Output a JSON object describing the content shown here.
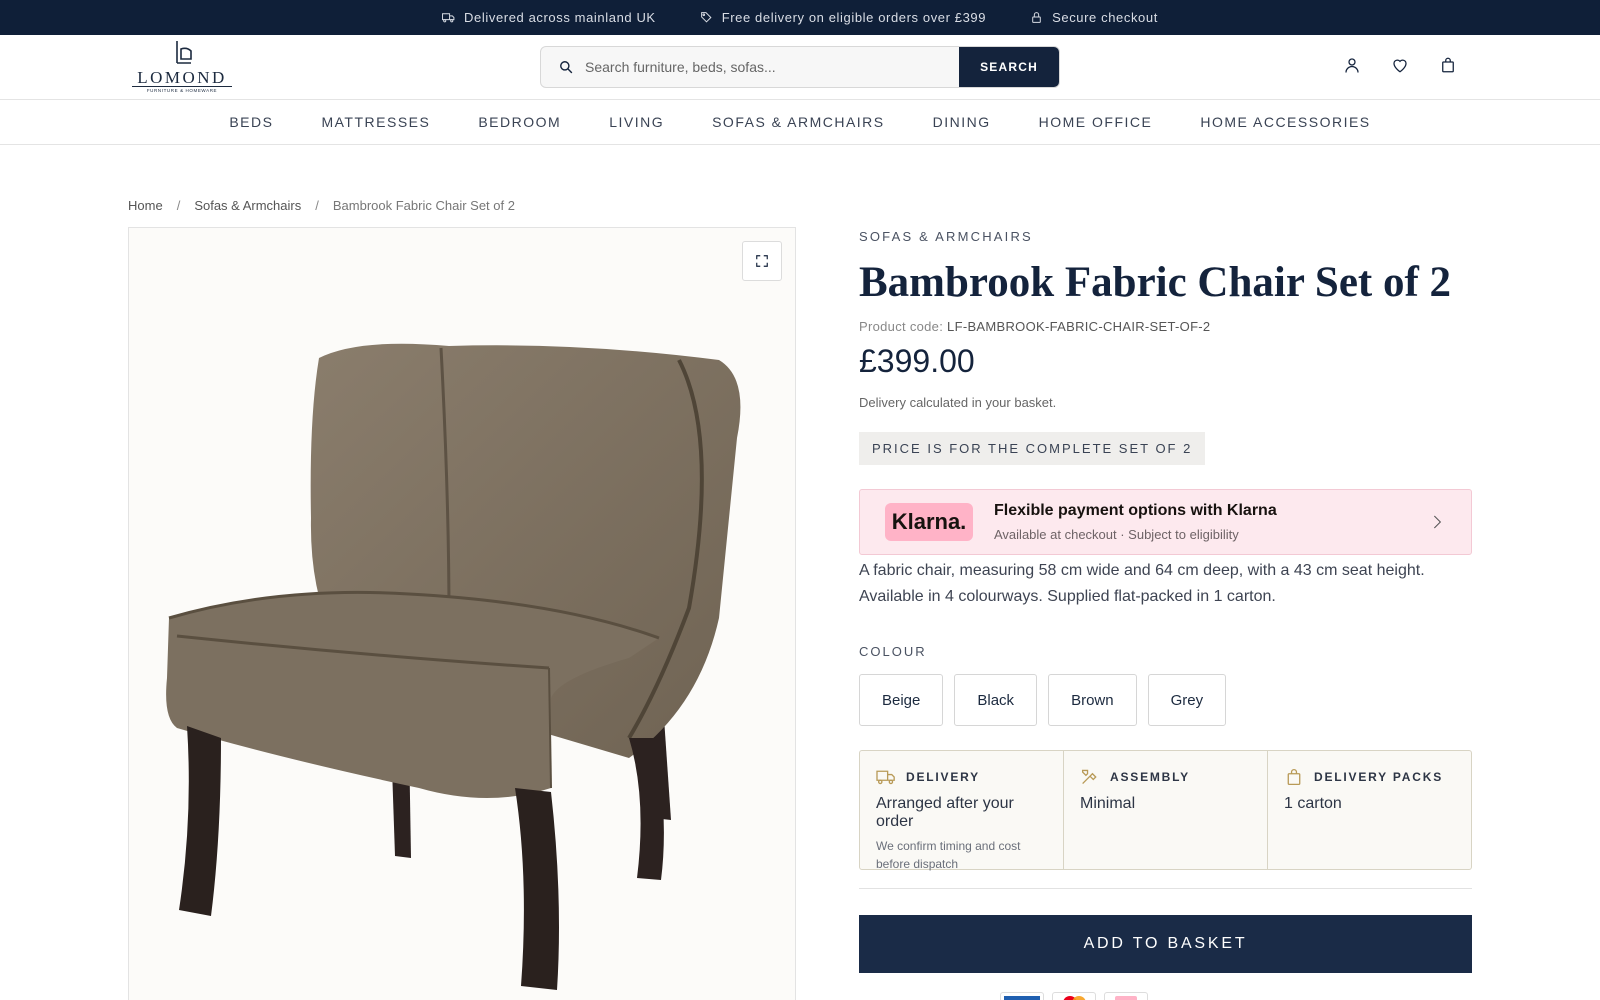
{
  "announcement": {
    "items": [
      {
        "icon": "truck-icon",
        "text": "Delivered across mainland UK"
      },
      {
        "icon": "tag-icon",
        "text": "Free delivery on eligible orders over £399"
      },
      {
        "icon": "lock-icon",
        "text": "Secure checkout"
      }
    ]
  },
  "header": {
    "logo_word": "LOMOND",
    "logo_sub": "FURNITURE & HOMEWARE",
    "search_placeholder": "Search furniture, beds, sofas...",
    "search_button": "SEARCH",
    "icons": [
      "account-icon",
      "wishlist-heart-icon",
      "basket-bag-icon"
    ]
  },
  "nav": {
    "items": [
      "BEDS",
      "MATTRESSES",
      "BEDROOM",
      "LIVING",
      "SOFAS & ARMCHAIRS",
      "DINING",
      "HOME OFFICE",
      "HOME ACCESSORIES"
    ]
  },
  "breadcrumb": {
    "home": "Home",
    "category": "Sofas & Armchairs",
    "current": "Bambrook Fabric Chair Set of 2",
    "separator": "/"
  },
  "product": {
    "category": "SOFAS & ARMCHAIRS",
    "title": "Bambrook Fabric Chair Set of 2",
    "code_label": "Product code:",
    "code_value": "LF-BAMBROOK-FABRIC-CHAIR-SET-OF-2",
    "price": "£399.00",
    "delivery_note": "Delivery calculated in your basket.",
    "set_badge": "PRICE IS FOR THE COMPLETE SET OF 2",
    "description": "A fabric chair, measuring 58 cm wide and 64 cm deep, with a 43 cm seat height. Available in 4 colourways. Supplied flat-packed in 1 carton.",
    "colour_label": "COLOUR",
    "colours": [
      "Beige",
      "Black",
      "Brown",
      "Grey"
    ],
    "add_to_basket": "ADD TO BASKET"
  },
  "klarna": {
    "logo_text": "Klarna.",
    "title": "Flexible payment options with Klarna",
    "subtitle": "Available at checkout · Subject to eligibility"
  },
  "info": {
    "delivery": {
      "heading": "DELIVERY",
      "value": "Arranged after your order",
      "note": "We confirm timing and cost before dispatch"
    },
    "assembly": {
      "heading": "ASSEMBLY",
      "value": "Minimal"
    },
    "packs": {
      "heading": "DELIVERY PACKS",
      "value": "1 carton"
    }
  },
  "colors": {
    "announcement_bg": "#0f1f38",
    "primary_navy": "#14233c",
    "klarna_pink": "#ffb3c7",
    "info_accent": "#b89a57"
  }
}
